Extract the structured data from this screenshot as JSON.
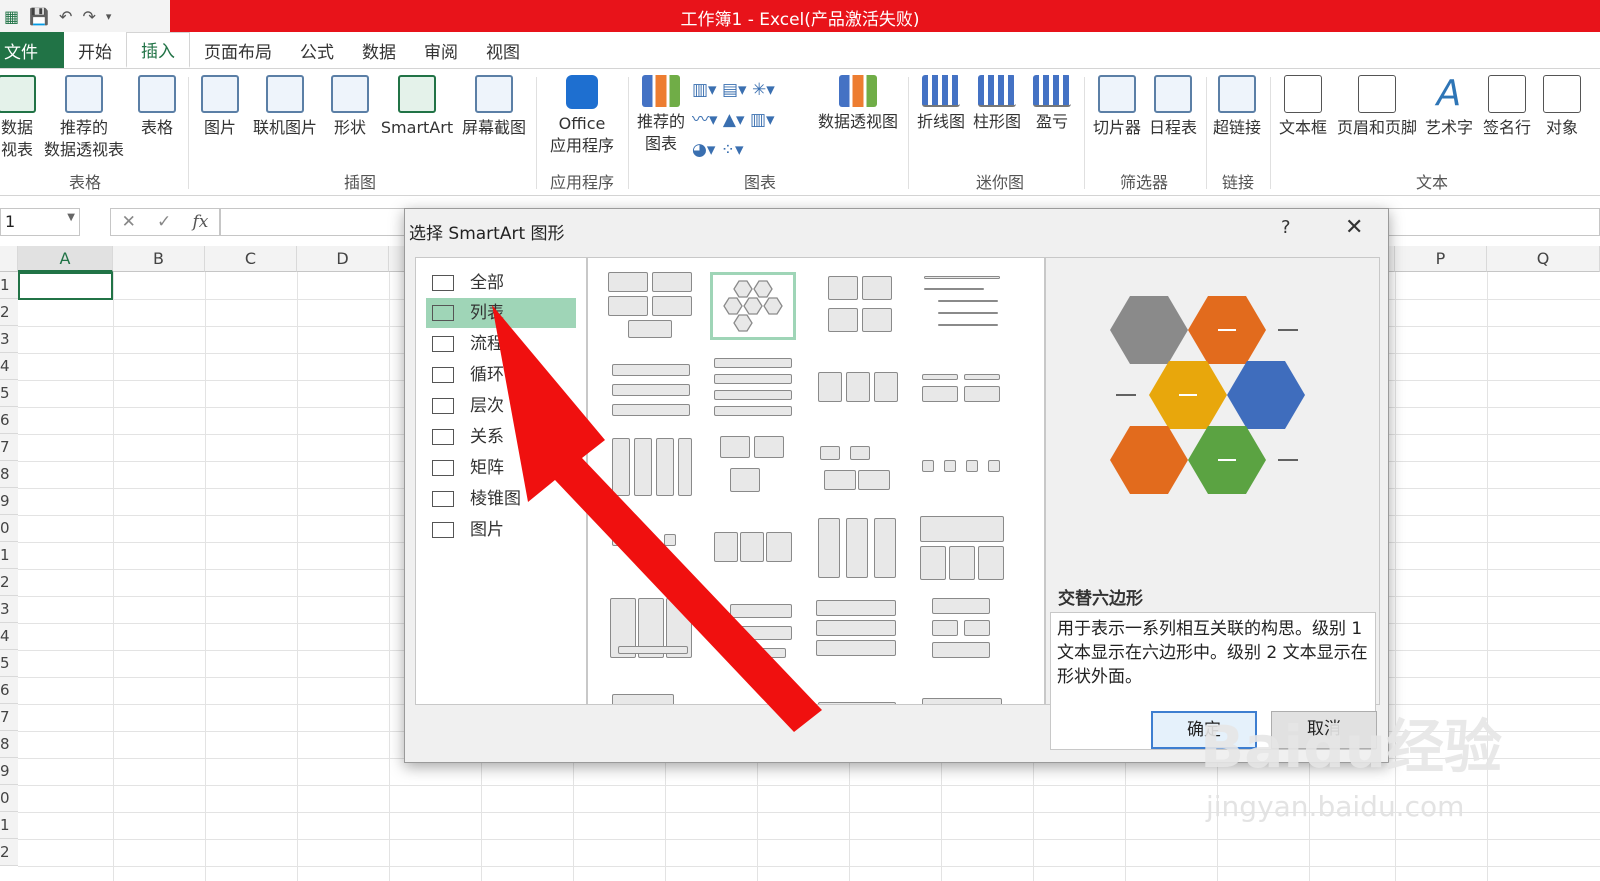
{
  "window": {
    "title": "工作簿1 -  Excel(产品激活失败)"
  },
  "tabs": [
    "文件",
    "开始",
    "插入",
    "页面布局",
    "公式",
    "数据",
    "审阅",
    "视图"
  ],
  "ribbon": {
    "buttons": [
      {
        "label": "数据\n视表"
      },
      {
        "label": "推荐的\n数据透视表"
      },
      {
        "label": "表格"
      },
      {
        "label": "图片"
      },
      {
        "label": "联机图片"
      },
      {
        "label": "形状"
      },
      {
        "label": "SmartArt"
      },
      {
        "label": "屏幕截图"
      },
      {
        "label": "Office\n应用程序"
      },
      {
        "label": "推荐的\n图表"
      },
      {
        "label": "数据透视图"
      },
      {
        "label": "折线图"
      },
      {
        "label": "柱形图"
      },
      {
        "label": "盈亏"
      },
      {
        "label": "切片器"
      },
      {
        "label": "日程表"
      },
      {
        "label": "超链接"
      },
      {
        "label": "文本框"
      },
      {
        "label": "页眉和页脚"
      },
      {
        "label": "艺术字"
      },
      {
        "label": "签名行"
      },
      {
        "label": "对象"
      }
    ],
    "groups": [
      "表格",
      "插图",
      "应用程序",
      "图表",
      "迷你图",
      "筛选器",
      "链接",
      "文本"
    ]
  },
  "formula_bar": {
    "name_box": "1",
    "fx": "fx"
  },
  "columns": [
    "A",
    "B",
    "C",
    "D",
    "P",
    "Q"
  ],
  "rows": [
    "1",
    "2",
    "3",
    "4",
    "5",
    "6",
    "7",
    "8",
    "9",
    "0",
    "1",
    "2",
    "3",
    "4",
    "5",
    "6",
    "7",
    "8",
    "9",
    "0",
    "1",
    "2"
  ],
  "dialog": {
    "title": "选择 SmartArt 图形",
    "help": "?",
    "close": "✕",
    "categories": [
      "全部",
      "列表",
      "流程",
      "循环",
      "层次",
      "关系",
      "矩阵",
      "棱锥图",
      "图片"
    ],
    "selected_category": "列表",
    "preview_title": "交替六边形",
    "preview_desc": "用于表示一系列相互关联的构思。级别 1 文本显示在六边形中。级别 2 文本显示在形状外面。",
    "ok": "确定",
    "cancel": "取消"
  },
  "watermark": {
    "line1": "Baidu经验",
    "line2": "jingyan.baidu.com"
  },
  "colors": {
    "title_bar": "#e8131a",
    "excel_green": "#217346",
    "arrow": "#f0100f",
    "selection": "#9fd5b7"
  }
}
